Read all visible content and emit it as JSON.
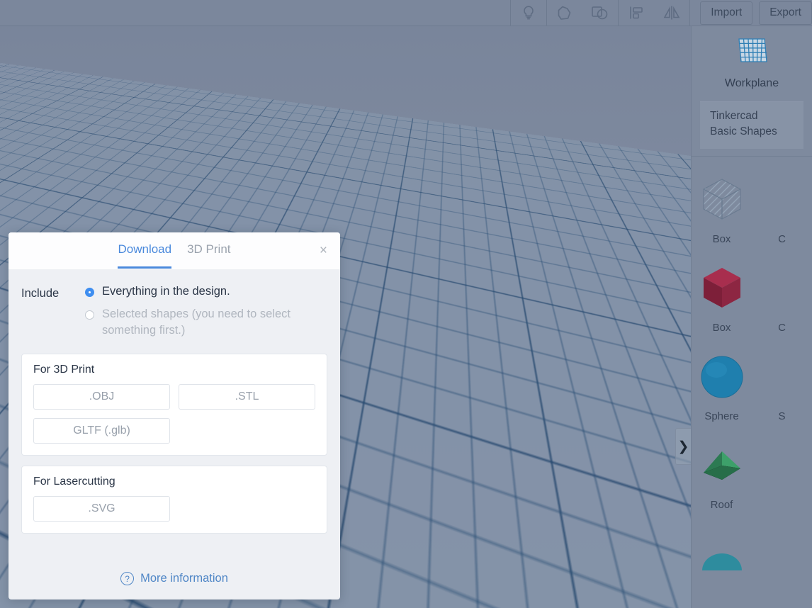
{
  "toolbar": {
    "icons": [
      {
        "name": "lightbulb-icon",
        "label": "Light"
      },
      {
        "name": "shape-generator-icon",
        "label": "Shape generator"
      },
      {
        "name": "group-icon",
        "label": "Group"
      },
      {
        "name": "align-icon",
        "label": "Align"
      },
      {
        "name": "mirror-icon",
        "label": "Mirror"
      }
    ],
    "import_label": "Import",
    "export_label": "Export"
  },
  "shapes_panel": {
    "workplane_label": "Workplane",
    "library_line1": "Tinkercad",
    "library_line2": "Basic Shapes",
    "collapse_glyph": "❯",
    "shapes": [
      {
        "name": "Box",
        "kind": "hole-box"
      },
      {
        "name": "C",
        "kind": "partial"
      },
      {
        "name": "Box",
        "kind": "solid-box",
        "color": "#9e2847"
      },
      {
        "name": "C",
        "kind": "partial"
      },
      {
        "name": "Sphere",
        "kind": "sphere",
        "color": "#1f7fae"
      },
      {
        "name": "S",
        "kind": "partial"
      },
      {
        "name": "Roof",
        "kind": "roof",
        "color": "#2f8a5b"
      },
      {
        "name": "",
        "kind": "partial"
      },
      {
        "name": "",
        "kind": "dome",
        "color": "#2e8c9e"
      },
      {
        "name": "",
        "kind": "partial"
      }
    ]
  },
  "dialog": {
    "tabs": [
      {
        "label": "Download",
        "active": true
      },
      {
        "label": "3D Print",
        "active": false
      }
    ],
    "close_glyph": "×",
    "include_label": "Include",
    "options": [
      {
        "label": "Everything in the design.",
        "selected": true,
        "disabled": false
      },
      {
        "label": "Selected shapes (you need to select something first.)",
        "selected": false,
        "disabled": true
      }
    ],
    "sections": [
      {
        "title": "For 3D Print",
        "buttons": [
          ".OBJ",
          ".STL",
          "GLTF (.glb)"
        ]
      },
      {
        "title": "For Lasercutting",
        "buttons": [
          ".SVG"
        ]
      }
    ],
    "more_information": "More information",
    "help_glyph": "?"
  },
  "colors": {
    "accent": "#4a89dc",
    "radio_on": "#3e8ef0",
    "link": "#4f86c6",
    "viewport_bg": "#7e8a9e",
    "dialog_bg": "#eef0f4"
  }
}
